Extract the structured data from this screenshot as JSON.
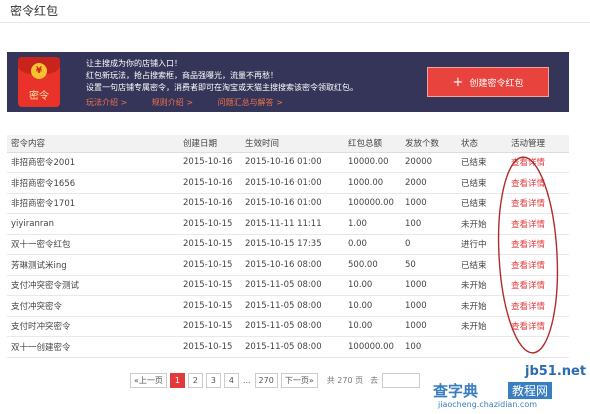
{
  "page": {
    "title": "密令红包"
  },
  "banner": {
    "envelope_label": "密令",
    "coin_symbol": "¥",
    "line1": "让主搜成为你的店铺入口！",
    "line2": "红包新玩法，抢占搜索框，商品强曝光，流量不再愁！",
    "line3": "设置一句店铺专属密令，消费者即可在淘宝或天猫主搜搜索该密令领取红包。",
    "links": [
      "玩法介绍 >",
      "规则介绍 >",
      "问题汇总与解答 >"
    ]
  },
  "create_button": {
    "icon": "plus-icon",
    "plus": "+",
    "label": "创建密令红包"
  },
  "table": {
    "headers": [
      "密令内容",
      "创建日期",
      "生效时间",
      "红包总额",
      "发放个数",
      "状态",
      "活动管理"
    ],
    "rows": [
      [
        "非招商密令2001",
        "2015-10-16",
        "2015-10-16 01:00",
        "10000.00",
        "20000",
        "已结束",
        "查看详情"
      ],
      [
        "非招商密令1656",
        "2015-10-16",
        "2015-10-16 01:00",
        "1000.00",
        "2000",
        "已结束",
        "查看详情"
      ],
      [
        "非招商密令1701",
        "2015-10-16",
        "2015-10-16 01:00",
        "100000.00",
        "1000",
        "已结束",
        "查看详情"
      ],
      [
        "yiyiranran",
        "2015-10-15",
        "2015-11-11 11:11",
        "1.00",
        "100",
        "未开始",
        "查看详情"
      ],
      [
        "双十一密令红包",
        "2015-10-15",
        "2015-10-15 17:35",
        "0.00",
        "0",
        "进行中",
        "查看详情"
      ],
      [
        "芳琳测试米ing",
        "2015-10-15",
        "2015-10-16 08:00",
        "500.00",
        "50",
        "已结束",
        "查看详情"
      ],
      [
        "支付冲突密令测试",
        "2015-10-15",
        "2015-11-05 08:00",
        "10.00",
        "1000",
        "未开始",
        "查看详情"
      ],
      [
        "支付冲突密令",
        "2015-10-15",
        "2015-11-05 08:00",
        "10.00",
        "1000",
        "未开始",
        "查看详情"
      ],
      [
        "支付时冲突密令",
        "2015-10-15",
        "2015-11-05 08:00",
        "10.00",
        "1000",
        "未开始",
        "查看详情"
      ],
      [
        "双十一创建密令",
        "2015-10-15",
        "2015-11-05 08:00",
        "100000.00",
        "100",
        "",
        ""
      ]
    ]
  },
  "pagination": {
    "prev": "«上一页",
    "pages": [
      "1",
      "2",
      "3",
      "4"
    ],
    "ellipsis": "...",
    "last_page": "270",
    "next": "下一页»",
    "total": "共 270 页",
    "goto": "去",
    "active_color": "#e4393c"
  },
  "watermark": {
    "site": "jb51.net",
    "name": "查字典",
    "tag": "教程网",
    "url": "jiaocheng.chazidian.com"
  },
  "colors": {
    "banner_bg": "#35355a",
    "accent_red": "#e4393c",
    "link_orange": "#f27249"
  }
}
